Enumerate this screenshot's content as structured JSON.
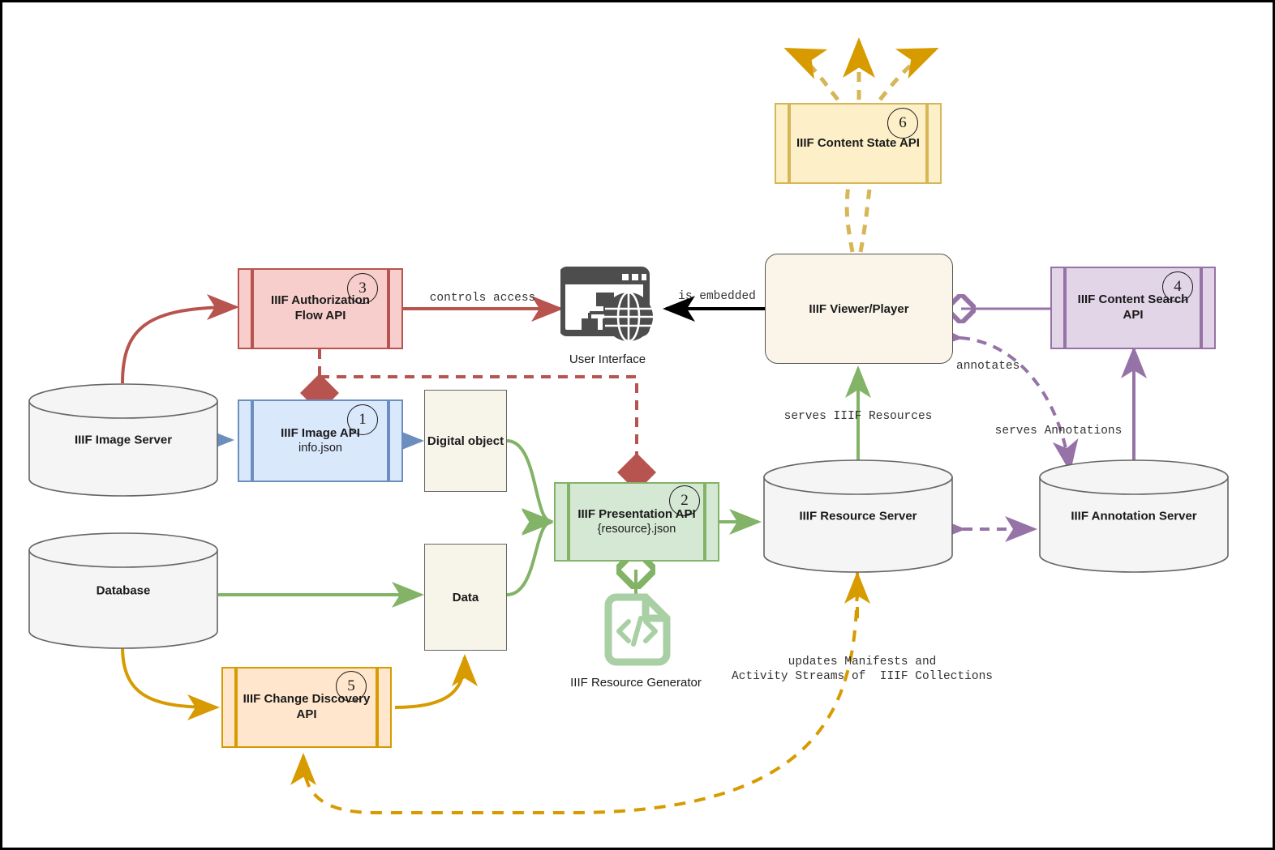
{
  "diagram": {
    "title": "IIIF APIs Architecture Diagram",
    "colors": {
      "red_fill": "#f8cecc",
      "red_stroke": "#b85450",
      "blue_fill": "#dae8fc",
      "blue_stroke": "#6c8ebf",
      "green_fill": "#d5e8d4",
      "green_stroke": "#82b366",
      "purple_fill": "#e1d5e7",
      "purple_stroke": "#9673a6",
      "orange_fill": "#ffe6cc",
      "orange_stroke": "#d79b00",
      "yellow_fill": "#fdf0c9",
      "yellow_stroke": "#d6b656",
      "neutral_fill": "#f5f5f5",
      "neutral_stroke": "#666666",
      "cream_fill": "#f7f4e9",
      "black": "#000000"
    }
  },
  "nodes": {
    "authorization_flow_api": {
      "title": "IIIF Authorization Flow API",
      "badge": "3"
    },
    "image_api": {
      "title": "IIIF Image API",
      "subtitle": "info.json",
      "badge": "1"
    },
    "presentation_api": {
      "title": "IIIF Presentation API",
      "subtitle": "{resource}.json",
      "badge": "2"
    },
    "content_search_api": {
      "title": "IIIF Content Search API",
      "badge": "4"
    },
    "change_discovery_api": {
      "title": "IIIF Change Discovery API",
      "badge": "5"
    },
    "content_state_api": {
      "title": "IIIF Content State API",
      "badge": "6"
    },
    "image_server": {
      "label": "IIIF Image Server"
    },
    "database": {
      "label": "Database"
    },
    "resource_server": {
      "label": "IIIF Resource Server"
    },
    "annotation_server": {
      "label": "IIIF Annotation Server"
    },
    "digital_object": {
      "label": "Digital object"
    },
    "data": {
      "label": "Data"
    },
    "viewer_player": {
      "label": "IIIF Viewer/Player"
    },
    "user_interface": {
      "label": "User Interface",
      "icon": "browser-globe-icon"
    },
    "resource_generator": {
      "label": "IIIF Resource Generator",
      "icon": "code-document-icon"
    }
  },
  "edge_labels": {
    "controls_access": "controls access",
    "is_embedded": "is embedded",
    "serves_iiif_resources": "serves IIIF Resources",
    "annotates": "annotates",
    "serves_annotations": "serves Annotations",
    "updates_manifests_line1": "updates Manifests and",
    "updates_manifests_line2": "Activity Streams of  IIIF Collections"
  }
}
